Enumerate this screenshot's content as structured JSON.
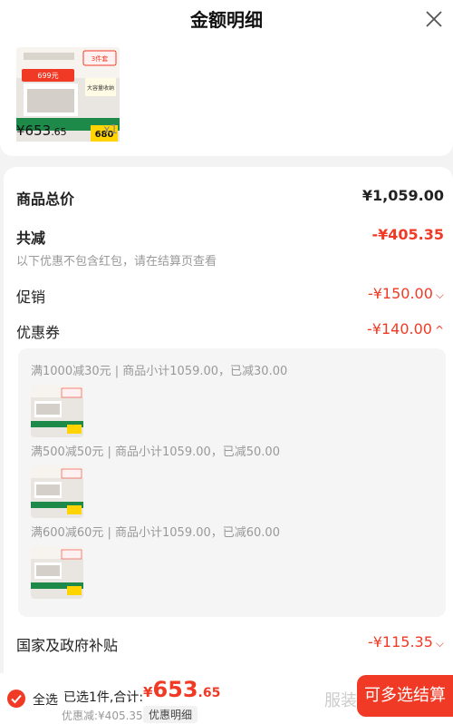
{
  "header": {
    "title": "金额明细"
  },
  "product": {
    "price_main": "¥653",
    "price_cents": ".65",
    "quantity": "x1",
    "image": {
      "badge_top": "3件套",
      "promo_price": "699元",
      "gift_text": "大容量收纳",
      "bottom_price": "680"
    }
  },
  "summary": {
    "goods_total_label": "商品总价",
    "goods_total_value": "¥1,059.00",
    "total_reduce_label": "共减",
    "total_reduce_value": "-¥405.35",
    "note": "以下优惠不包含红包，请在结算页查看",
    "promo_label": "促销",
    "promo_value": "-¥150.00",
    "coupon_label": "优惠券",
    "coupon_value": "-¥140.00",
    "coupons": [
      {
        "text": "满1000减30元 | 商品小计1059.00，已减30.00"
      },
      {
        "text": "满500减50元 | 商品小计1059.00，已减50.00"
      },
      {
        "text": "满600减60元 | 商品小计1059.00，已减60.00"
      }
    ],
    "subsidy_label": "国家及政府补贴",
    "subsidy_value": "-¥115.35"
  },
  "footer": {
    "select_all": "全选",
    "selected_text": "已选1件,合计:",
    "total_symbol": "¥",
    "total_main": "653",
    "total_cents": ".65",
    "discount_text": "优惠减:¥405.35",
    "detail_button": "优惠明细",
    "ghost_text": "服装",
    "checkout_button": "可多选结算"
  },
  "colors": {
    "accent": "#f03a25",
    "text": "#222222",
    "muted": "#999999",
    "background": "#f3f3f3"
  },
  "icons": {
    "close": "close-icon",
    "chevron_down": "chevron-down-icon",
    "chevron_up": "chevron-up-icon",
    "check": "check-icon"
  }
}
